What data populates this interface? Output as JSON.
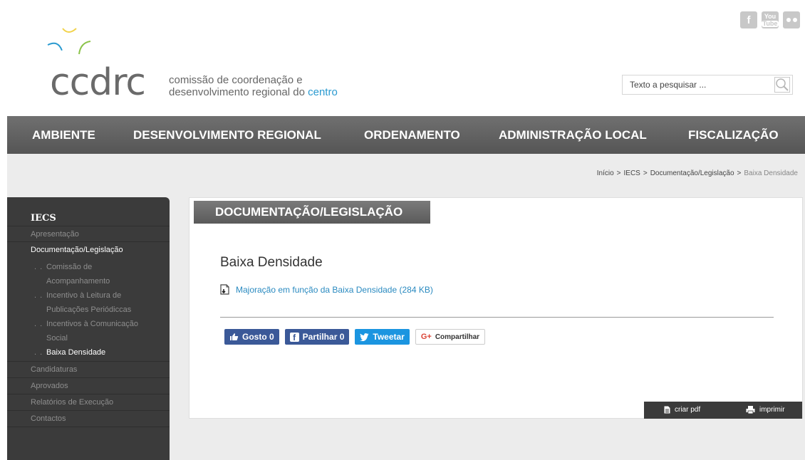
{
  "logo": {
    "word": "ccdrc",
    "tagline_line1": "comissão de coordenação e",
    "tagline_line2_prefix": "desenvolvimento regional do ",
    "tagline_line2_accent": "centro"
  },
  "social": {
    "facebook": "f",
    "youtube_top": "You",
    "youtube_bottom": "Tube",
    "icons": [
      "facebook-icon",
      "youtube-icon",
      "flickr-icon"
    ]
  },
  "search": {
    "placeholder": "Texto a pesquisar ..."
  },
  "nav": {
    "items": [
      "AMBIENTE",
      "DESENVOLVIMENTO REGIONAL",
      "ORDENAMENTO",
      "ADMINISTRAÇÃO LOCAL",
      "FISCALIZAÇÃO"
    ]
  },
  "breadcrumb": {
    "items": [
      "Início",
      "IECS",
      "Documentação/Legislação"
    ],
    "current": "Baixa Densidade",
    "separator": ">"
  },
  "sidebar": {
    "title": "IECS",
    "apresentacao": "Apresentação",
    "documentacao": "Documentação/Legislação",
    "sub_bullet": ". .",
    "sub": [
      {
        "line1": "Comissão de",
        "line2": "Acompanhamento"
      },
      {
        "line1": "Incentivo à Leitura de",
        "line2": "Publicações Periódiccas"
      },
      {
        "line1": "Incentivos à Comunicação",
        "line2": "Social"
      },
      {
        "line1": "Baixa Densidade"
      }
    ],
    "candidaturas": "Candidaturas",
    "aprovados": "Aprovados",
    "relatorios": "Relatórios de Execução",
    "contactos": "Contactos"
  },
  "content": {
    "section_title": "DOCUMENTAÇÃO/LEGISLAÇÃO",
    "heading": "Baixa Densidade",
    "doc_link": "Majoração em função da Baixa Densidade (284 KB)"
  },
  "share": {
    "like": "Gosto 0",
    "fb_share": "Partilhar 0",
    "tweet": "Tweetar",
    "gplus": "Compartilhar",
    "gplus_icon": "G+"
  },
  "actions": {
    "pdf": "criar pdf",
    "print": "imprimir"
  },
  "colors": {
    "nav_bg": "#5e5e5e",
    "sidebar_bg": "#3b3b3b",
    "link": "#2a8ac0",
    "accent": "#2a9ad0",
    "logo_yellow": "#f2d34a",
    "logo_blue": "#2a9ad0",
    "logo_green": "#8bc34a",
    "facebook": "#3b5998",
    "twitter": "#1b95e0"
  }
}
